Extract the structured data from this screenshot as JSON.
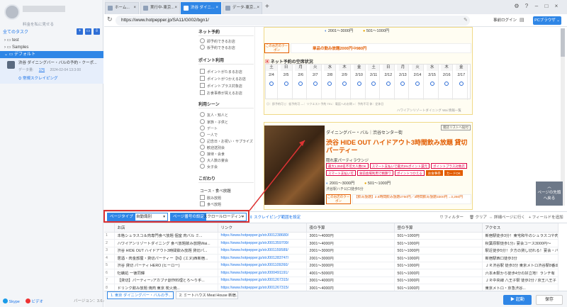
{
  "sidebar": {
    "user_sub": "料金を私に見せる",
    "all_tasks": "全てのタスク",
    "tree": [
      {
        "label": "test",
        "active": false
      },
      {
        "label": "Samples",
        "active": false
      },
      {
        "label": "デフォルト",
        "active": true
      }
    ],
    "task": {
      "title": "渋谷 ダイニングバー・バルの予約・クーポ...",
      "meta_label": "データ量:",
      "meta_count": "176",
      "meta_date": "2024-02-04 13:3:00",
      "action": "常規スクレイピング"
    },
    "skype": "Skype",
    "video": "ビデオ",
    "version": "バージョン：3.6.4"
  },
  "tabs": [
    {
      "label": "ホーム..."
    },
    {
      "label": "実行中-東京..."
    },
    {
      "label": "渋谷 ダイニ..."
    },
    {
      "label": "データ-東京..."
    }
  ],
  "address": {
    "url": "https://www.hotpepper.jp/SA11/G002/bgn1/",
    "login": "事前ログイン",
    "browser_mode": "PCブラウザ"
  },
  "filters": {
    "net_reserve": {
      "title": "ネット予約",
      "items": [
        "即予約できるお店",
        "仮予約できるお店"
      ]
    },
    "points": {
      "title": "ポイント利用",
      "items": [
        "ポイントがたまるお店",
        "ポイントがつかえるお店",
        "ポイントプラス対象店",
        "お食事券が買えるお店"
      ]
    },
    "scene": {
      "title": "利用シーン",
      "items": [
        "友人・知人と",
        "家族・子供と",
        "デート",
        "一人で",
        "記念日・お祝い・サプライズ",
        "歓迎送別会",
        "接待・会食",
        "大人数の宴会",
        "女子会"
      ]
    },
    "kodawari": {
      "title": "こだわり",
      "sub": "コース・食べ放題",
      "items": [
        "飲み放題",
        "食べ放題"
      ]
    }
  },
  "shop1": {
    "budget_dinner": "2001～3000円",
    "budget_lunch": "501～1000円",
    "deal": "単品の飲み放題2000円⇒980円",
    "coupon_label": "このお店のクーポン",
    "calendar_title": "ネット予約の空席状況",
    "days": [
      {
        "dw": "土",
        "dt": "2/4",
        "red": true
      },
      {
        "dw": "日",
        "dt": "2/5",
        "red": true
      },
      {
        "dw": "月",
        "dt": "2/6",
        "red": false
      },
      {
        "dw": "火",
        "dt": "2/7",
        "red": false
      },
      {
        "dw": "水",
        "dt": "2/8",
        "red": false
      },
      {
        "dw": "木",
        "dt": "2/9",
        "red": false
      },
      {
        "dw": "金",
        "dt": "2/10",
        "red": false
      },
      {
        "dw": "土",
        "dt": "2/11",
        "red": true
      },
      {
        "dw": "日",
        "dt": "2/12",
        "red": true
      },
      {
        "dw": "月",
        "dt": "2/13",
        "red": false
      },
      {
        "dw": "火",
        "dt": "2/14",
        "red": false
      },
      {
        "dw": "水",
        "dt": "2/15",
        "red": false
      },
      {
        "dw": "木",
        "dt": "2/16",
        "red": false
      },
      {
        "dw": "金",
        "dt": "2/17",
        "red": false
      }
    ]
  },
  "shop2": {
    "genre": "ダイニングバー・バル｜渋谷センター街",
    "name": "渋谷 HIDE OUT ハイドアウト3時間飲み放題 貸切パーティー",
    "tagline": "隠れ家パーティラウンジ",
    "tags": [
      "最大1,050名不可大人数OK",
      "スマート支払いで最大5%ポイント還元",
      "ポイントプラス対象店",
      "スマート支払い可",
      "食前会場利用で精算ワ",
      "ポイントつかえる",
      "お食事券",
      "カードOK"
    ],
    "budget_dinner": "2001～3000円",
    "budget_lunch": "501～1000円",
    "access": "渋谷駅ハチ公口徒歩5分",
    "coupon": "【飲み放題】2.5時間飲み放題2750円／3時間飲み放題3300円→3,260円",
    "top_badge": "雑誌リストへ貼付"
  },
  "scroll_panel": "ページの先頭へ戻る",
  "toolbar": {
    "page_type_label": "ページタイプ",
    "page_type_value": "自動識別",
    "page_set_label": "ページ番号の設定",
    "page_set_value": "スクロールローディング",
    "scroll_range": "スクレイピング範囲を設定",
    "filter": "フィルター",
    "clear": "クリア",
    "preview": "詳細ページに行く",
    "field_add": "フィールドを追加"
  },
  "table": {
    "headers": [
      "お店",
      "リンク",
      "夜の予算",
      "昼の予算",
      "アクセス"
    ],
    "rows": [
      {
        "idx": "1",
        "shop": "本格シュラスコ＆肉専門食べ放題 個室 肉バル ミ...",
        "link": "https://www.hotpepper.jp/strJ001238680/",
        "night": "3001～4000円",
        "day": "501～1000円",
        "access": "新宿駅徒歩3分！東宅和牛のシュラスコや肉寿"
      },
      {
        "idx": "2",
        "shop": "ハワイアンリゾートダイニング 食べ放題飲み放題Wai...",
        "link": "https://www.hotpepper.jp/strJ001359709/",
        "night": "3001～4000円",
        "day": "501～1000円",
        "access": "秋葉原駅徒歩1分♪ 宴会コース3000円～"
      },
      {
        "idx": "3",
        "shop": "渋谷 HIDE OUT ハイドアウト3時間飲み放題 貸切パ...",
        "link": "https://www.hotpepper.jp/strJ001159589/",
        "night": "2001～3000円",
        "day": "501～1000円",
        "access": "駅近徒歩5分！夕方の貸し切れる！宴会・パー"
      },
      {
        "idx": "4",
        "shop": "居酒・肉金部屋・貸切パーティー【N】(エヌ)西新宿...",
        "link": "https://www.hotpepper.jp/strJ001283747/",
        "night": "2001～3000円",
        "day": "501～1000円",
        "access": "新宿駅西口徒歩3分"
      },
      {
        "idx": "5",
        "shop": "渋谷 貸切 パーティ HERO (ヒーロー)",
        "link": "https://www.hotpepper.jp/strJ001109260/",
        "night": "2001～3000円",
        "day": "501～1000円",
        "access": "ＪＲ渋谷駅 徒歩3分 東京メトロ渋谷駅8番出"
      },
      {
        "idx": "6",
        "shop": "牡蠣処 一徳同輝",
        "link": "https://www.hotpepper.jp/strJ000491191/",
        "night": "4001～5000円",
        "day": "501～1000円",
        "access": "六本木駅から徒歩4分の好立地！ランチ有"
      },
      {
        "idx": "7",
        "shop": "【貸切】パーティー♪アカブナ創作料理とろ～り手...",
        "link": "https://www.hotpepper.jp/strJ001267315/",
        "night": "3001～4000円",
        "day": "501～1000円",
        "access": "ＪＲ中央線 八王子駅 徒歩2分 / 京王八王子"
      },
      {
        "idx": "8",
        "shop": "ドリンク飲み放題 焼肉 東京 炭火焼...",
        "link": "https://www.hotpepper.jp/strJ001267315/",
        "night": "3001～4000円",
        "day": "501～1000円",
        "access": "東京メトロ・京急渋谷..."
      }
    ]
  },
  "bottom_tabs": [
    "1. 東京 ダイニングバー・バルの予...",
    "2. ミートハウス Meat House 新宿..."
  ],
  "run": "▶ 起動",
  "save": "保存",
  "colors": {
    "accent": "#2f86e6",
    "highlight": "#d33333",
    "brand_orange": "#e25c00"
  }
}
